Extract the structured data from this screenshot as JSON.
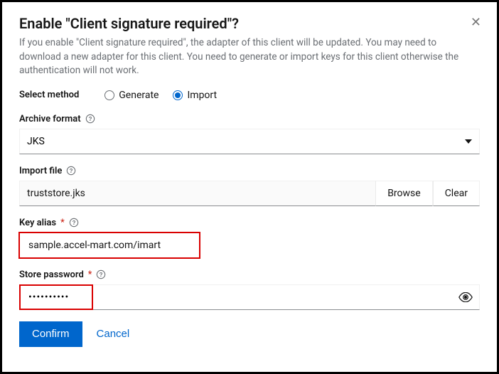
{
  "dialog": {
    "title": "Enable \"Client signature required\"?",
    "description": "If you enable \"Client signature required\", the adapter of this client will be updated. You may need to download a new adapter for this client. You need to generate or import keys for this client otherwise the authentication will not work."
  },
  "method": {
    "label": "Select method",
    "options": {
      "generate": "Generate",
      "import": "Import"
    },
    "selected": "import"
  },
  "archive_format": {
    "label": "Archive format",
    "value": "JKS"
  },
  "import_file": {
    "label": "Import file",
    "value": "truststore.jks",
    "browse": "Browse",
    "clear": "Clear"
  },
  "key_alias": {
    "label": "Key alias",
    "value": "sample.accel-mart.com/imart"
  },
  "store_password": {
    "label": "Store password",
    "value": "••••••••••"
  },
  "buttons": {
    "confirm": "Confirm",
    "cancel": "Cancel"
  }
}
